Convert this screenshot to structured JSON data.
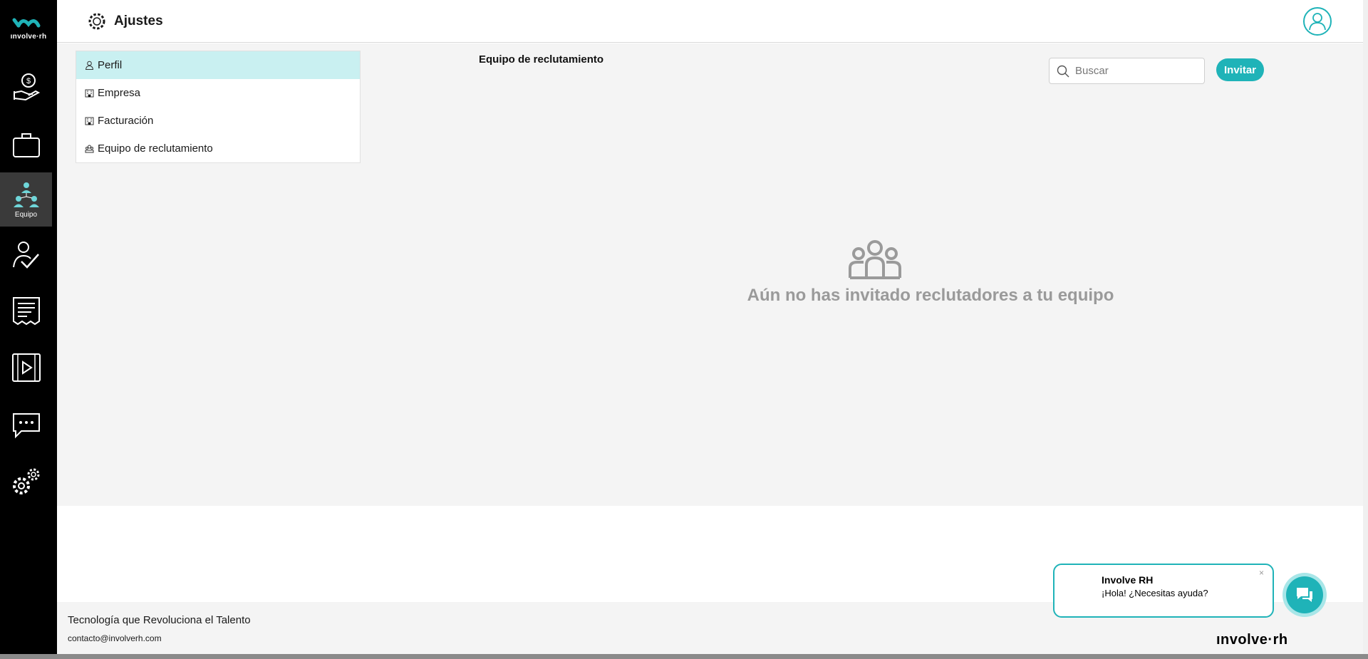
{
  "brand": {
    "logo_text": "ınvolve·rh",
    "accent": "#1fb3b8"
  },
  "sidebar": {
    "items": [
      {
        "name": "payments",
        "icon": "hand-money-icon",
        "label": ""
      },
      {
        "name": "jobs",
        "icon": "briefcase-icon",
        "label": ""
      },
      {
        "name": "team",
        "icon": "team-icon",
        "label": "Equipo"
      },
      {
        "name": "evaluation",
        "icon": "person-check-icon",
        "label": ""
      },
      {
        "name": "invoices",
        "icon": "receipt-icon",
        "label": ""
      },
      {
        "name": "videos",
        "icon": "video-icon",
        "label": ""
      },
      {
        "name": "messages",
        "icon": "chat-icon",
        "label": ""
      },
      {
        "name": "settings",
        "icon": "gears-icon",
        "label": ""
      }
    ]
  },
  "header": {
    "title": "Ajustes"
  },
  "settings_menu": {
    "items": [
      {
        "label": "Perfil",
        "icon": "user-icon"
      },
      {
        "label": "Empresa",
        "icon": "building-icon"
      },
      {
        "label": "Facturación",
        "icon": "building-icon"
      },
      {
        "label": "Equipo de reclutamiento",
        "icon": "team-small-icon"
      }
    ]
  },
  "main": {
    "section_title": "Equipo de reclutamiento",
    "search_placeholder": "Buscar",
    "invite_label": "Invitar",
    "empty_message": "Aún no has invitado reclutadores a tu equipo"
  },
  "footer": {
    "tagline": "Tecnología que Revoluciona el Talento",
    "email": "contacto@involverh.com",
    "logo_text": "ınvolve·rh"
  },
  "chat": {
    "name": "Involve RH",
    "message": "¡Hola! ¿Necesitas ayuda?",
    "close": "×"
  }
}
